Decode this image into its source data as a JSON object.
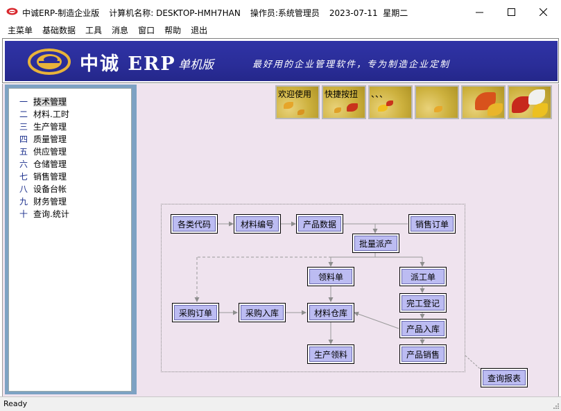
{
  "window": {
    "app_title": "中诚ERP-制造企业版",
    "computer_label": "计算机名称:",
    "computer_name": "DESKTOP-HMH7HAN",
    "operator_label": "操作员:",
    "operator_name": "系统管理员",
    "date": "2023-07-11",
    "weekday": "星期二",
    "minimize": "—",
    "maximize": "☐",
    "close": "✕"
  },
  "menu": [
    "主菜单",
    "基础数据",
    "工具",
    "消息",
    "窗口",
    "帮助",
    "退出"
  ],
  "banner": {
    "brand": "中诚 ERP",
    "edition": "单机版",
    "slogan": "最好用的企业管理软件，专为制造企业定制"
  },
  "sidebar": {
    "items": [
      {
        "num": "一",
        "label": "技术管理"
      },
      {
        "num": "二",
        "label": "材料.工时"
      },
      {
        "num": "三",
        "label": "生产管理"
      },
      {
        "num": "四",
        "label": "质量管理"
      },
      {
        "num": "五",
        "label": "供应管理"
      },
      {
        "num": "六",
        "label": "仓储管理"
      },
      {
        "num": "七",
        "label": "销售管理"
      },
      {
        "num": "八",
        "label": "设备台帐"
      },
      {
        "num": "九",
        "label": "财务管理"
      },
      {
        "num": "十",
        "label": "查询.统计"
      }
    ]
  },
  "tiles": [
    {
      "label": "欢迎使用"
    },
    {
      "label": "快捷按扭"
    },
    {
      "label": "、、、"
    },
    {
      "label": ""
    },
    {
      "label": ""
    },
    {
      "label": ""
    }
  ],
  "flow": {
    "codes": "各类代码",
    "material_no": "材料编号",
    "product_data": "产品数据",
    "sales_order": "销售订单",
    "batch_dispatch": "批量派产",
    "requisition": "领料单",
    "dispatch_work": "派工单",
    "complete_register": "完工登记",
    "purchase_order": "采购订单",
    "purchase_in": "采购入库",
    "material_store": "材料仓库",
    "product_in": "产品入库",
    "prod_requisition": "生产领料",
    "product_sales": "产品销售",
    "query_report": "查询报表"
  },
  "status": {
    "text": "Ready"
  },
  "colors": {
    "banner_blue": "#2a2d98",
    "client_bg": "#efe3ee",
    "node_fill": "#bcbcf2",
    "sidebar_frame": "#7da2c3",
    "number_color": "#1a2e8c"
  }
}
